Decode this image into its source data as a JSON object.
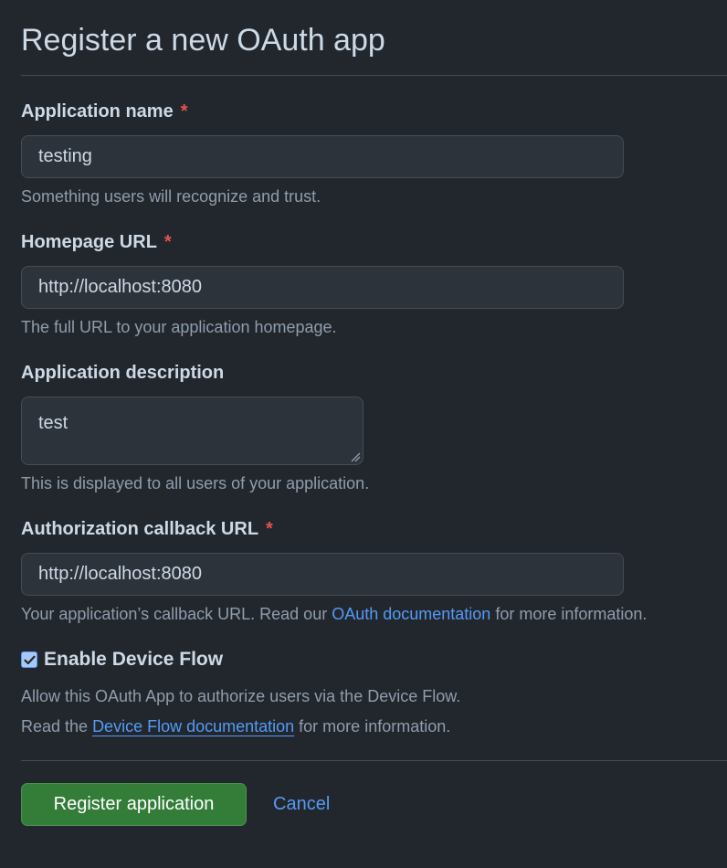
{
  "page": {
    "title": "Register a new OAuth app"
  },
  "fields": {
    "app_name": {
      "label": "Application name",
      "required_mark": "*",
      "value": "testing",
      "hint": "Something users will recognize and trust."
    },
    "homepage_url": {
      "label": "Homepage URL",
      "required_mark": "*",
      "value": "http://localhost:8080",
      "hint": "The full URL to your application homepage."
    },
    "description": {
      "label": "Application description",
      "value": "test",
      "hint": "This is displayed to all users of your application."
    },
    "callback_url": {
      "label": "Authorization callback URL",
      "required_mark": "*",
      "value": "http://localhost:8080",
      "hint_prefix": "Your application’s callback URL. Read our ",
      "hint_link": "OAuth documentation",
      "hint_suffix": " for more information."
    }
  },
  "device_flow": {
    "label": "Enable Device Flow",
    "checked": true,
    "note_line1": "Allow this OAuth App to authorize users via the Device Flow.",
    "note_line2_prefix": "Read the ",
    "note_line2_link": "Device Flow documentation",
    "note_line2_suffix": " for more information."
  },
  "actions": {
    "register_label": "Register application",
    "cancel_label": "Cancel"
  },
  "colors": {
    "background": "#22272e",
    "input_bg": "#2d333b",
    "border": "#444c56",
    "required": "#e5534b",
    "link": "#539bf5",
    "primary_button": "#347d39"
  },
  "icons": {
    "checkbox": "checkmark-icon",
    "textarea_resize": "resize-grip-icon"
  }
}
